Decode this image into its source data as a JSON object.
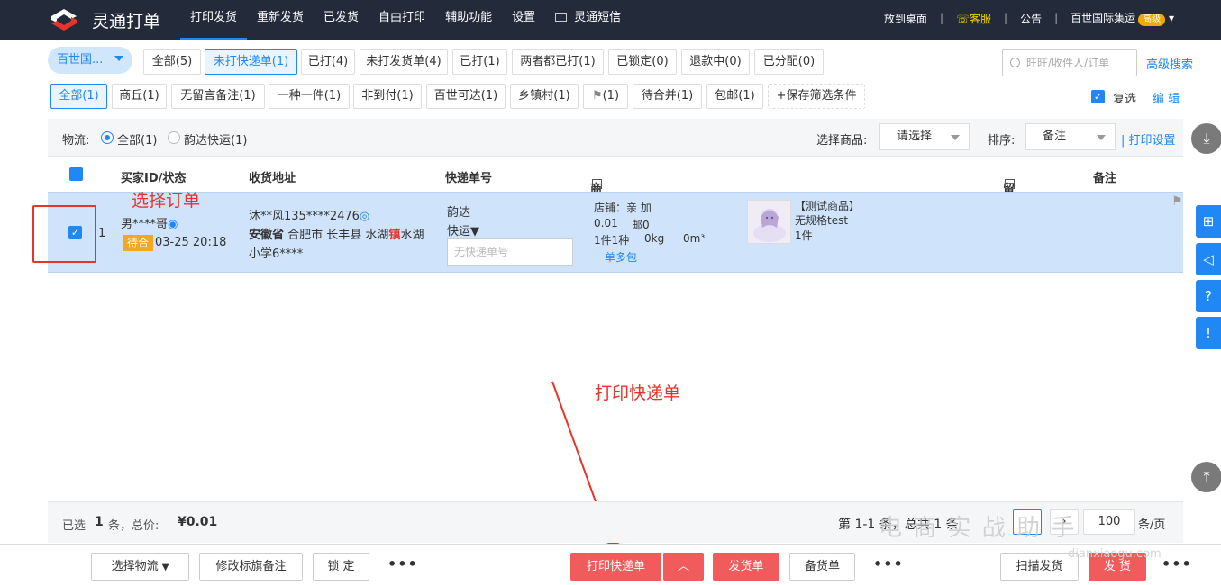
{
  "brand": {
    "name": "灵通打单"
  },
  "nav": [
    "打印发货",
    "重新发货",
    "已发货",
    "自由打印",
    "辅助功能",
    "设置",
    "灵通短信"
  ],
  "topright": {
    "desktop": "放到桌面",
    "kefu": "客服",
    "notice": "公告",
    "account": "百世国际集运",
    "vip": "高级"
  },
  "company_select": "百世国...",
  "status_tabs": [
    "全部(5)",
    "未打快递单(1)",
    "已打(4)",
    "未打发货单(4)",
    "已打(1)",
    "两者都已打(1)",
    "已锁定(0)",
    "退款中(0)",
    "已分配(0)"
  ],
  "search": {
    "placeholder": "旺旺/收件人/订单",
    "advanced": "高级搜索"
  },
  "filter_tags": [
    "全部(1)",
    "商丘(1)",
    "无留言备注(1)",
    "一种一件(1)",
    "非到付(1)",
    "百世可达(1)",
    "乡镇村(1)",
    "(1)",
    "待合并(1)",
    "包邮(1)",
    "+保存筛选条件"
  ],
  "multi": {
    "label": "复选",
    "edit": "编 辑"
  },
  "filterbar": {
    "logistics_label": "物流:",
    "opt_all": "全部(1)",
    "opt_yunda": "韵达快运(1)",
    "goods_label": "选择商品:",
    "goods_value": "请选择",
    "sort_label": "排序:",
    "sort_value": "备注",
    "print_settings": "| 打印设置"
  },
  "table_headers": {
    "buyer": "买家ID/状态",
    "address": "收货地址",
    "express": "快递单号",
    "goods": "商品信息",
    "message": "留言",
    "remark": "备注"
  },
  "order": {
    "index": "1",
    "buyer": "男****哥",
    "status": "待合",
    "time": "03-25 20:18",
    "addr_line1": "沐**风135****2476",
    "addr_province": "安徽省",
    "addr_rest_a": "合肥市 长丰县 水湖",
    "addr_highlight": "镇",
    "addr_rest_b": "水湖",
    "addr_line3": "小学6****",
    "express_company": "韵达",
    "express_type": "快运",
    "express_placeholder": "无快递单号",
    "shop": "店铺：亲 加",
    "price": "0.01",
    "post": "邮0",
    "stats_a": "1件1种",
    "stats_b": "0kg",
    "stats_c": "0m³",
    "multi_pack": "一单多包",
    "product_title": "【测试商品】",
    "product_spec": "无规格test",
    "product_qty": "1件"
  },
  "annotations": {
    "select_order": "选择订单",
    "print_express": "打印快递单"
  },
  "summary": {
    "selected_prefix": "已选",
    "selected_count": "1",
    "selected_suffix": "条，总价:",
    "total": "¥0.01",
    "paging": "第 1-1 条，总共 1 条",
    "per_page": "100",
    "unit": "条/页"
  },
  "bottom": {
    "choose_logistics": "选择物流",
    "modify_flag": "修改标旗备注",
    "lock": "锁 定",
    "more": "•••",
    "print_express": "打印快递单",
    "ship_doc": "发货单",
    "pick_doc": "备货单",
    "scan_ship": "扫描发货",
    "ship": "发 货"
  },
  "watermark": {
    "main": "电 商 实 战 助 手",
    "sub": "dianxiaogu.com"
  }
}
